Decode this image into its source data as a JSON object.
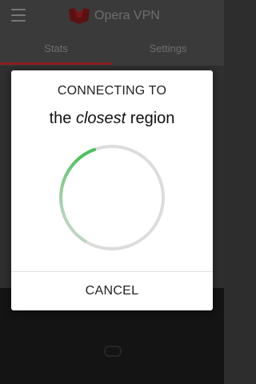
{
  "app": {
    "name": "Opera VPN",
    "icons": {
      "menu": "hamburger-menu-icon",
      "logo": "opera-vpn-logo"
    },
    "brand_color": "#c4151c"
  },
  "tabs": [
    {
      "label": "Stats",
      "active": true
    },
    {
      "label": "Settings",
      "active": false
    }
  ],
  "dialog": {
    "line1": "CONNECTING TO",
    "line2_prefix": "the",
    "line2_emphasis": "closest",
    "line2_suffix": "region",
    "cancel_label": "CANCEL",
    "spinner_color": "#49c25b",
    "track_color": "#dcdcdc"
  }
}
